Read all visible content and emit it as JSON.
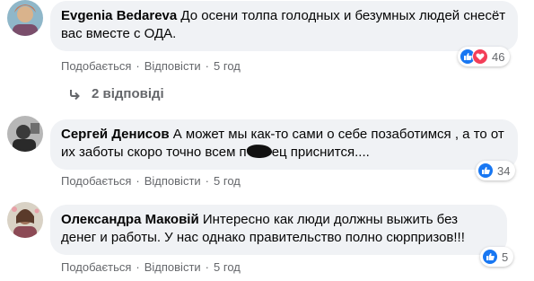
{
  "comments": [
    {
      "author": "Evgenia Bedareva",
      "text": "До осени толпа голодных и безумных людей снесёт вас вместе с ОДА.",
      "like_label": "Подобається",
      "reply_label": "Відповісти",
      "time": "5 год",
      "reaction_count": "46",
      "reactions": [
        "like-icon",
        "love-icon"
      ]
    },
    {
      "author": "Сергей Денисов",
      "text_before": "А может мы как-то сами о себе позаботимся , а то от их заботы скоро точно всем п",
      "text_after": "ец приснится....",
      "like_label": "Подобається",
      "reply_label": "Відповісти",
      "time": "5 год",
      "reaction_count": "34",
      "reactions": [
        "like-icon"
      ]
    },
    {
      "author": "Олександра Маковій",
      "text": "Интересно как люди должны выжить без денег и работы. У нас однако правительство полно сюрпризов!!!",
      "like_label": "Подобається",
      "reply_label": "Відповісти",
      "time": "5 год",
      "reaction_count": "5",
      "reactions": [
        "like-icon"
      ]
    }
  ],
  "replies_link": "2 відповіді",
  "colors": {
    "bubble": "#f0f2f5",
    "meta_text": "#65676b",
    "like_blue": "#1877f2",
    "love_red": "#f33e58"
  }
}
